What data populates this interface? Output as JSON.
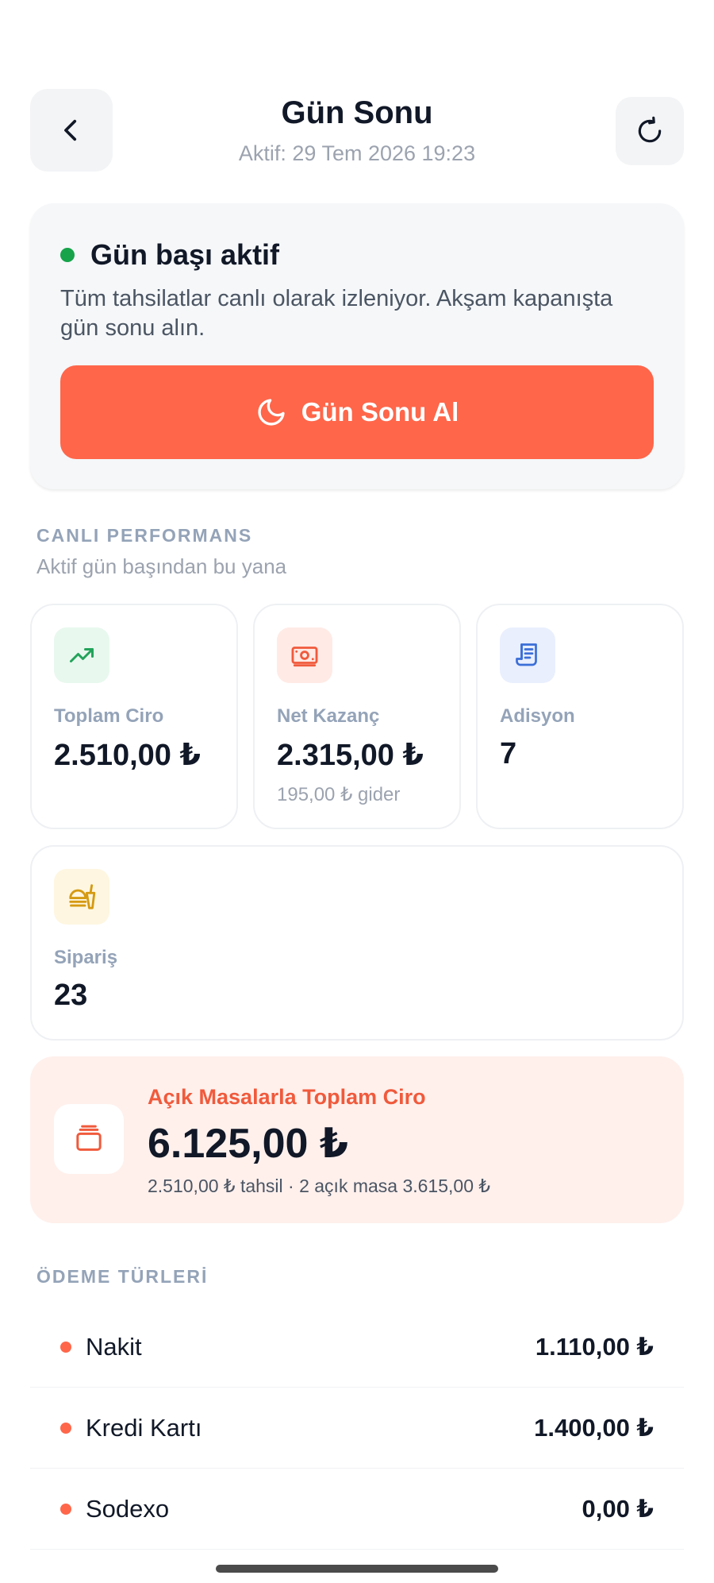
{
  "header": {
    "title": "Gün Sonu",
    "subtitle": "Aktif: 29 Tem 2026 19:23",
    "back_icon": "chevron-left-icon",
    "refresh_icon": "refresh-icon"
  },
  "status": {
    "title": "Gün başı aktif",
    "description": "Tüm tahsilatlar canlı olarak izleniyor. Akşam kapanışta gün sonu alın.",
    "button_label": "Gün Sonu Al",
    "button_icon": "moon-icon",
    "dot_color": "#16a34a",
    "accent_color": "#ff664a"
  },
  "performance": {
    "section_title": "CANLI PERFORMANS",
    "section_subtitle": "Aktif gün başından bu yana",
    "cards": [
      {
        "label": "Toplam Ciro",
        "value": "2.510,00 ₺",
        "note": "",
        "icon": "trending-up-icon"
      },
      {
        "label": "Net Kazanç",
        "value": "2.315,00 ₺",
        "note": "195,00 ₺ gider",
        "icon": "banknote-icon"
      },
      {
        "label": "Adisyon",
        "value": "7",
        "note": "",
        "icon": "receipt-icon"
      },
      {
        "label": "Sipariş",
        "value": "23",
        "note": "",
        "icon": "fast-food-icon"
      }
    ]
  },
  "open_tables": {
    "title": "Açık Masalarla Toplam Ciro",
    "value": "6.125,00 ₺",
    "note": "2.510,00 ₺ tahsil · 2 açık masa 3.615,00 ₺",
    "icon": "cash-register-icon"
  },
  "payments": {
    "section_title": "ÖDEME TÜRLERİ",
    "items": [
      {
        "name": "Nakit",
        "value": "1.110,00 ₺"
      },
      {
        "name": "Kredi Kartı",
        "value": "1.400,00 ₺"
      },
      {
        "name": "Sodexo",
        "value": "0,00 ₺"
      }
    ]
  }
}
